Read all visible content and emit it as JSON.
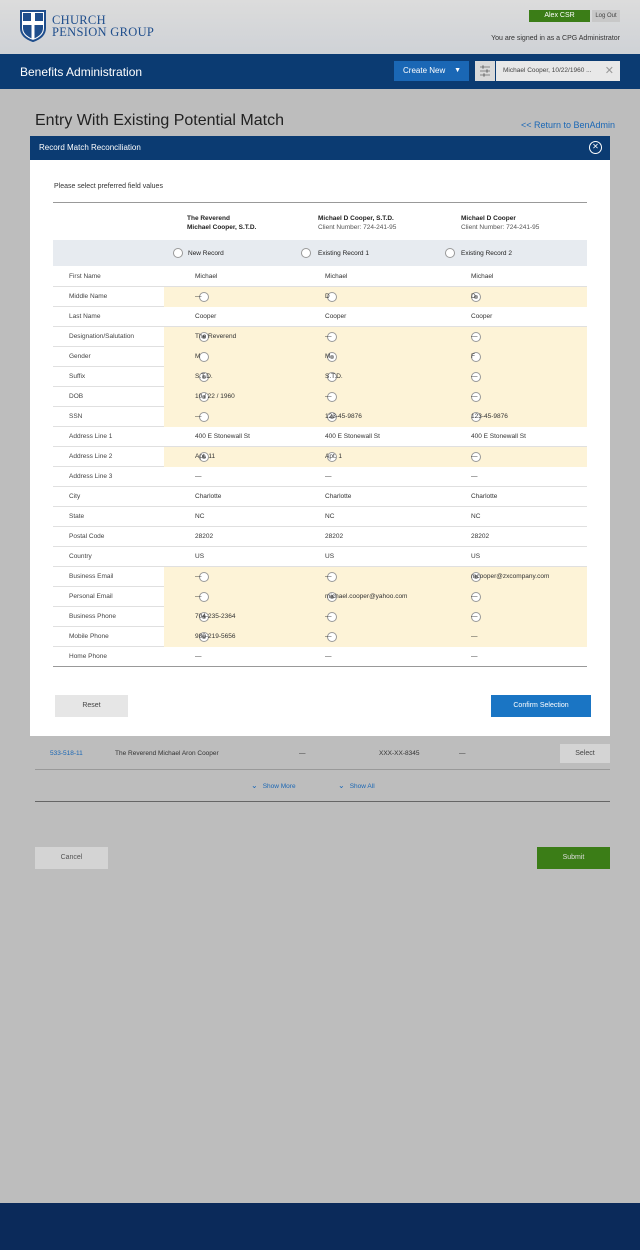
{
  "header": {
    "logo_line1": "CHURCH",
    "logo_line2": "PENSION GROUP",
    "user_button": "Alex CSR",
    "logout_button": "Log Out",
    "signed_in_text": "You are signed in as a CPG Administrator"
  },
  "appbar": {
    "title": "Benefits Administration",
    "create_new": "Create New",
    "context_chip": "Michael Cooper, 10/22/1960 ..."
  },
  "page": {
    "title": "Entry With Existing Potential Match",
    "return_link": "<< Return to BenAdmin"
  },
  "modal": {
    "title": "Record Match Reconciliation",
    "intro": "Please select preferred field values",
    "columns": [
      {
        "line1": "The Reverend",
        "line2": "Michael Cooper, S.T.D.",
        "select_label": "New Record"
      },
      {
        "line1": "Michael D Cooper, S.T.D.",
        "line2": "Client Number: 724-241-95",
        "select_label": "Existing Record 1"
      },
      {
        "line1": "Michael D Cooper",
        "line2": "Client Number: 724-241-95",
        "select_label": "Existing Record 2"
      }
    ],
    "rows": [
      {
        "label": "First Name",
        "values": [
          "Michael",
          "Michael",
          "Michael"
        ],
        "radios": [
          null,
          null,
          null
        ]
      },
      {
        "label": "Middle Name",
        "values": [
          "—",
          "D",
          "D"
        ],
        "radios": [
          false,
          false,
          true
        ]
      },
      {
        "label": "Last Name",
        "values": [
          "Cooper",
          "Cooper",
          "Cooper"
        ],
        "radios": [
          null,
          null,
          null
        ]
      },
      {
        "label": "Designation/Salutation",
        "values": [
          "The Reverend",
          "—",
          "—"
        ],
        "radios": [
          true,
          false,
          false
        ]
      },
      {
        "label": "Gender",
        "values": [
          "M",
          "M",
          "F"
        ],
        "radios": [
          false,
          true,
          false
        ]
      },
      {
        "label": "Suffix",
        "values": [
          "S.T.D.",
          "S.T.D.",
          "—"
        ],
        "radios": [
          true,
          false,
          false
        ]
      },
      {
        "label": "DOB",
        "values": [
          "10 / 22 / 1960",
          "—",
          "—"
        ],
        "radios": [
          true,
          false,
          false
        ]
      },
      {
        "label": "SSN",
        "values": [
          "—",
          "123-45-9876",
          "123-45-9876"
        ],
        "radios": [
          false,
          true,
          false
        ]
      },
      {
        "label": "Address Line 1",
        "values": [
          "400 E Stonewall St",
          "400 E Stonewall St",
          "400 E Stonewall St"
        ],
        "radios": [
          null,
          null,
          null
        ]
      },
      {
        "label": "Address Line 2",
        "values": [
          "Apt. 11",
          "Apt. 1",
          "—"
        ],
        "radios": [
          true,
          false,
          false
        ]
      },
      {
        "label": "Address Line 3",
        "values": [
          "—",
          "—",
          "—"
        ],
        "radios": [
          null,
          null,
          null
        ]
      },
      {
        "label": "City",
        "values": [
          "Charlotte",
          "Charlotte",
          "Charlotte"
        ],
        "radios": [
          null,
          null,
          null
        ]
      },
      {
        "label": "State",
        "values": [
          "NC",
          "NC",
          "NC"
        ],
        "radios": [
          null,
          null,
          null
        ]
      },
      {
        "label": "Postal Code",
        "values": [
          "28202",
          "28202",
          "28202"
        ],
        "radios": [
          null,
          null,
          null
        ]
      },
      {
        "label": "Country",
        "values": [
          "US",
          "US",
          "US"
        ],
        "radios": [
          null,
          null,
          null
        ]
      },
      {
        "label": "Business Email",
        "values": [
          "—",
          "—",
          "mcooper@zxcompany.com"
        ],
        "radios": [
          false,
          false,
          true
        ]
      },
      {
        "label": "Personal Email",
        "values": [
          "—",
          "michael.cooper@yahoo.com",
          "—"
        ],
        "radios": [
          false,
          true,
          false
        ]
      },
      {
        "label": "Business Phone",
        "values": [
          "704-235-2364",
          "—",
          "—"
        ],
        "radios": [
          true,
          false,
          false
        ]
      },
      {
        "label": "Mobile Phone",
        "values": [
          "980-219-5656",
          "—",
          "—"
        ],
        "radios": [
          true,
          false,
          null
        ]
      },
      {
        "label": "Home Phone",
        "values": [
          "—",
          "—",
          "—"
        ],
        "radios": [
          null,
          null,
          null
        ]
      }
    ],
    "reset": "Reset",
    "confirm": "Confirm Selection"
  },
  "results": {
    "row": {
      "id": "533-518-11",
      "name": "The Reverend Michael Aron Cooper",
      "col3": "—",
      "ssn": "XXX-XX-8345",
      "col5": "—",
      "select": "Select"
    },
    "show_more": "Show More",
    "show_all": "Show All"
  },
  "actions": {
    "cancel": "Cancel",
    "submit": "Submit"
  },
  "colors": {
    "brand_navy": "#0b3b72",
    "accent_blue": "#1a75c4",
    "success_green": "#3b7d17",
    "highlight": "#fdf3d7"
  }
}
